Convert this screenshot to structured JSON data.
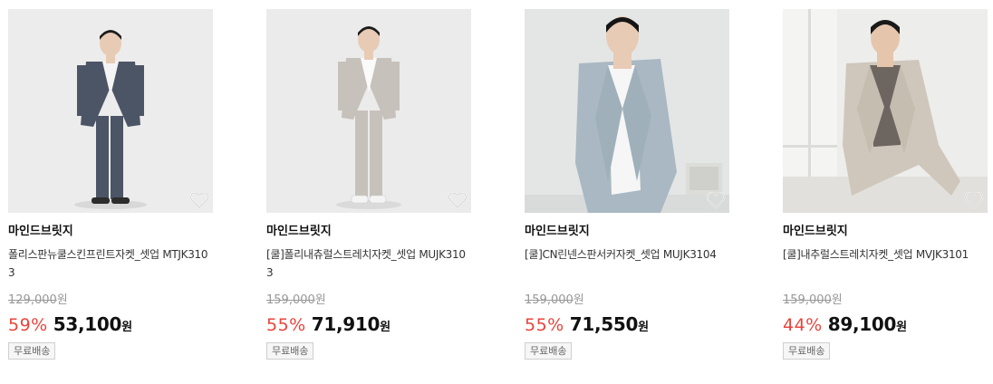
{
  "products": [
    {
      "brand": "마인드브릿지",
      "name": "폴리스판뉴쿨스킨프린트자켓_셋업 MTJK3103",
      "original_price": "129,000",
      "original_won": "원",
      "discount": "59%",
      "sale_price": "53,100",
      "sale_won": "원",
      "shipping": "무료배송",
      "image": {
        "bg": "#ececec",
        "suit": "#4c5566",
        "inner": "#f4f4f4",
        "shoes": "#2c2c2c",
        "skin": "#e8cbb5",
        "hair": "#1c1c1c"
      }
    },
    {
      "brand": "마인드브릿지",
      "name": "[쿨]폴리내츄럴스트레치자켓_셋업 MUJK3103",
      "original_price": "159,000",
      "original_won": "원",
      "discount": "55%",
      "sale_price": "71,910",
      "sale_won": "원",
      "shipping": "무료배송",
      "image": {
        "bg": "#ebebeb",
        "suit": "#c7c1bc",
        "inner": "#fafafa",
        "shoes": "#f4f4f4",
        "skin": "#e8cbb5",
        "hair": "#1c1c1c"
      }
    },
    {
      "brand": "마인드브릿지",
      "name": "[쿨]CN린넨스판서커자켓_셋업 MUJK3104",
      "original_price": "159,000",
      "original_won": "원",
      "discount": "55%",
      "sale_price": "71,550",
      "sale_won": "원",
      "shipping": "무료배송",
      "image": {
        "bg": "#e4e6e6",
        "suit": "#a9b8c2",
        "inner": "#f6f6f6",
        "shoes": "#9aa9b3",
        "skin": "#e8cbb5",
        "hair": "#151515"
      }
    },
    {
      "brand": "마인드브릿지",
      "name": "[쿨]내추럴스트레치자켓_셋업 MVJK3101",
      "original_price": "159,000",
      "original_won": "원",
      "discount": "44%",
      "sale_price": "89,100",
      "sale_won": "원",
      "shipping": "무료배송",
      "image": {
        "bg": "#ededeb",
        "suit": "#cfc7bc",
        "inner": "#6d6660",
        "shoes": "#cfc7bc",
        "skin": "#e5c6ad",
        "hair": "#1a1a1a"
      }
    }
  ],
  "colors": {
    "discount": "#e8453c",
    "price": "#111111",
    "strike": "#999999"
  }
}
